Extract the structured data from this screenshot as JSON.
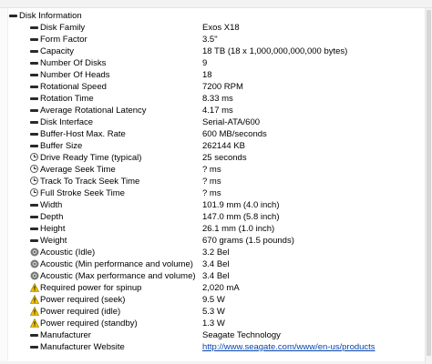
{
  "section": {
    "title": "Disk Information",
    "icon": "section-dash-icon"
  },
  "rows": [
    {
      "label": "Disk Family",
      "value": "Exos X18",
      "icon": "dash-icon"
    },
    {
      "label": "Form Factor",
      "value": "3.5\"",
      "icon": "dash-icon"
    },
    {
      "label": "Capacity",
      "value": "18 TB (18 x 1,000,000,000,000 bytes)",
      "icon": "dash-icon"
    },
    {
      "label": "Number Of Disks",
      "value": "9",
      "icon": "dash-icon"
    },
    {
      "label": "Number Of Heads",
      "value": "18",
      "icon": "dash-icon"
    },
    {
      "label": "Rotational Speed",
      "value": "7200 RPM",
      "icon": "dash-icon"
    },
    {
      "label": "Rotation Time",
      "value": "8.33 ms",
      "icon": "dash-icon"
    },
    {
      "label": "Average Rotational Latency",
      "value": "4.17 ms",
      "icon": "dash-icon"
    },
    {
      "label": "Disk Interface",
      "value": "Serial-ATA/600",
      "icon": "dash-icon"
    },
    {
      "label": "Buffer-Host Max. Rate",
      "value": "600 MB/seconds",
      "icon": "dash-icon"
    },
    {
      "label": "Buffer Size",
      "value": "262144 KB",
      "icon": "dash-icon"
    },
    {
      "label": "Drive Ready Time (typical)",
      "value": "25 seconds",
      "icon": "clock-icon"
    },
    {
      "label": "Average Seek Time",
      "value": "? ms",
      "icon": "clock-icon"
    },
    {
      "label": "Track To Track Seek Time",
      "value": "? ms",
      "icon": "clock-icon"
    },
    {
      "label": "Full Stroke Seek Time",
      "value": "? ms",
      "icon": "clock-icon"
    },
    {
      "label": "Width",
      "value": "101.9 mm (4.0 inch)",
      "icon": "dash-icon"
    },
    {
      "label": "Depth",
      "value": "147.0 mm (5.8 inch)",
      "icon": "dash-icon"
    },
    {
      "label": "Height",
      "value": "26.1 mm (1.0 inch)",
      "icon": "dash-icon"
    },
    {
      "label": "Weight",
      "value": "670 grams (1.5 pounds)",
      "icon": "dash-icon"
    },
    {
      "label": "Acoustic (Idle)",
      "value": "3.2 Bel",
      "icon": "speaker-icon"
    },
    {
      "label": "Acoustic (Min performance and volume)",
      "value": "3.4 Bel",
      "icon": "speaker-icon"
    },
    {
      "label": "Acoustic (Max performance and volume)",
      "value": "3.4 Bel",
      "icon": "speaker-icon"
    },
    {
      "label": "Required power for spinup",
      "value": "2,020 mA",
      "icon": "warning-icon"
    },
    {
      "label": "Power required (seek)",
      "value": "9.5 W",
      "icon": "warning-icon"
    },
    {
      "label": "Power required (idle)",
      "value": "5.3 W",
      "icon": "warning-icon"
    },
    {
      "label": "Power required (standby)",
      "value": "1.3 W",
      "icon": "warning-icon"
    },
    {
      "label": "Manufacturer",
      "value": "Seagate Technology",
      "icon": "dash-icon"
    },
    {
      "label": "Manufacturer Website",
      "value": "http://www.seagate.com/www/en-us/products",
      "icon": "dash-icon",
      "is_link": true
    }
  ],
  "colors": {
    "link": "#0645ad",
    "warning": "#f2c200",
    "icon_dark": "#2a2a2a"
  }
}
